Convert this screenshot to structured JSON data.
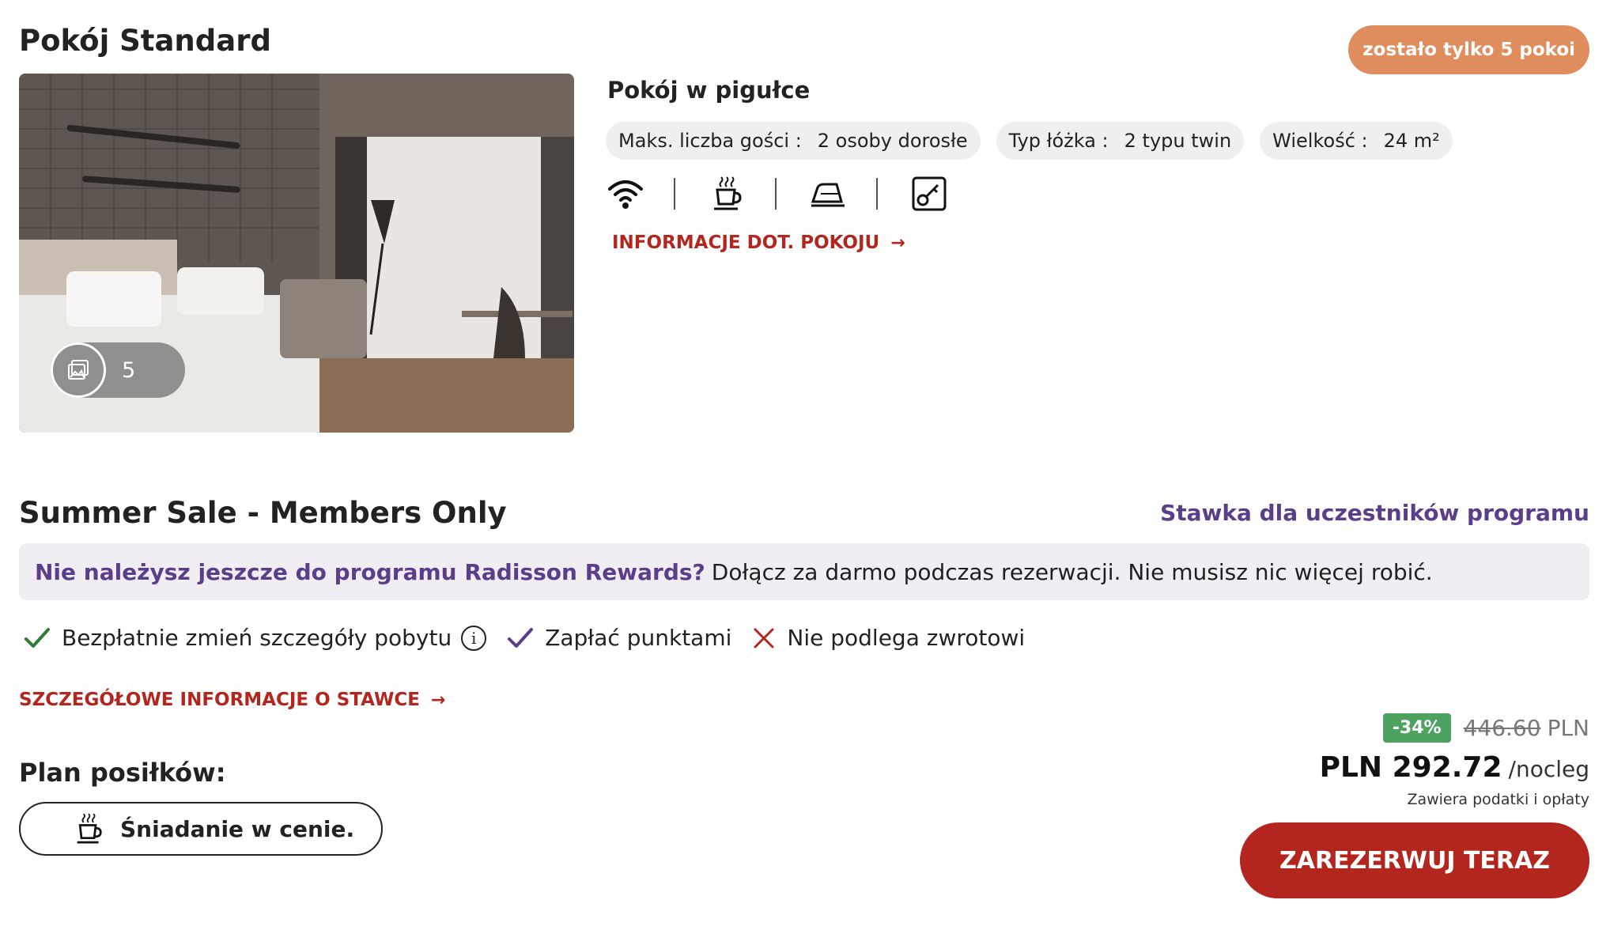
{
  "room": {
    "title": "Pokój Standard",
    "availability": "zostało tylko 5 pokoi",
    "gallery_count": "5",
    "summary_title": "Pokój w pigułce",
    "chips": [
      {
        "label": "Maks. liczba gości :",
        "value": "2 osoby dorosłe"
      },
      {
        "label": "Typ łóżka :",
        "value": "2 typu twin"
      },
      {
        "label": "Wielkość :",
        "value": "24 m²"
      }
    ],
    "amenity_icons": [
      "wifi-icon",
      "coffee-icon",
      "iron-icon",
      "key-card-icon"
    ],
    "info_link": "INFORMACJE DOT. POKOJU"
  },
  "rate": {
    "title": "Summer Sale - Members Only",
    "member_label": "Stawka dla uczestników programu",
    "promo_strong": "Nie należysz jeszcze do programu Radisson Rewards?",
    "promo_rest": "Dołącz za darmo podczas rezerwacji. Nie musisz nic więcej robić.",
    "conditions": [
      {
        "text": "Bezpłatnie zmień szczegóły pobytu",
        "icon": "check-icon",
        "color": "#2e7d32"
      },
      {
        "text": "Zapłać punktami",
        "icon": "check-icon",
        "color": "#5a3e8a"
      },
      {
        "text": "Nie podlega zwrotowi",
        "icon": "x-icon",
        "color": "#b3261e"
      }
    ],
    "details_link": "SZCZEGÓŁOWE INFORMACJE O STAWCE",
    "meal_label": "Plan posiłków:",
    "meal_option": "Śniadanie w cenie.",
    "discount": "-34%",
    "old_price": "446.60",
    "old_currency": "PLN",
    "price": "PLN 292.72",
    "price_unit": "/nocleg",
    "price_note": "Zawiera podatki i opłaty",
    "book_label": "ZAREZERWUJ TERAZ"
  },
  "colors": {
    "brand_red": "#b3261e",
    "member_purple": "#5a3e8a",
    "badge_orange": "#e08d5d",
    "discount_green": "#4ea25f"
  }
}
